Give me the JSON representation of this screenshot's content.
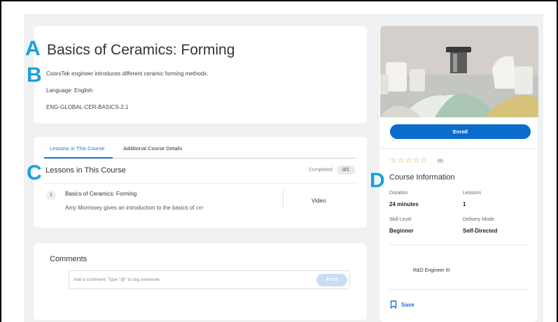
{
  "annotations": {
    "a": "A",
    "b": "B",
    "c": "C",
    "d": "D"
  },
  "course": {
    "title": "Basics of Ceramics: Forming",
    "description": "CoorsTek engineer introduces different ceramic forming methods.",
    "language": "Language: English",
    "code": "ENG-GLOBAL-CER-BASICS-2.1"
  },
  "tabs": [
    {
      "label": "Lessons in This Course",
      "active": true
    },
    {
      "label": "Additional Course Details",
      "active": false
    }
  ],
  "lessons_section": {
    "heading": "Lessons in This Course",
    "completed_label": "Completed",
    "completed_value": "0/1",
    "items": [
      {
        "number": "1",
        "title": "Basics of Ceramics: Forming",
        "subtitle": "Amy Morrissey gives an introduction to the basics of cer",
        "type": "Video"
      }
    ]
  },
  "comments": {
    "heading": "Comments",
    "placeholder": "Add a comment. Type \"@\" to tag someone.",
    "post_label": "Post"
  },
  "side": {
    "enroll_label": "Enroll",
    "rating_stars": 5,
    "rating_count": "(6)",
    "info_heading": "Course Information",
    "duration_label": "Duration",
    "duration_value": "24 minutes",
    "lessons_label": "Lessons",
    "lessons_value": "1",
    "skill_label": "Skill Level",
    "skill_value": "Beginner",
    "delivery_label": "Delivery Mode",
    "delivery_value": "Self-Directed",
    "role": "R&D Engineer III",
    "save_label": "Save"
  },
  "colors": {
    "accent": "#0b6ccc",
    "marker": "#1aa0dc",
    "star": "#e1a520",
    "background": "#f0f1f3"
  }
}
